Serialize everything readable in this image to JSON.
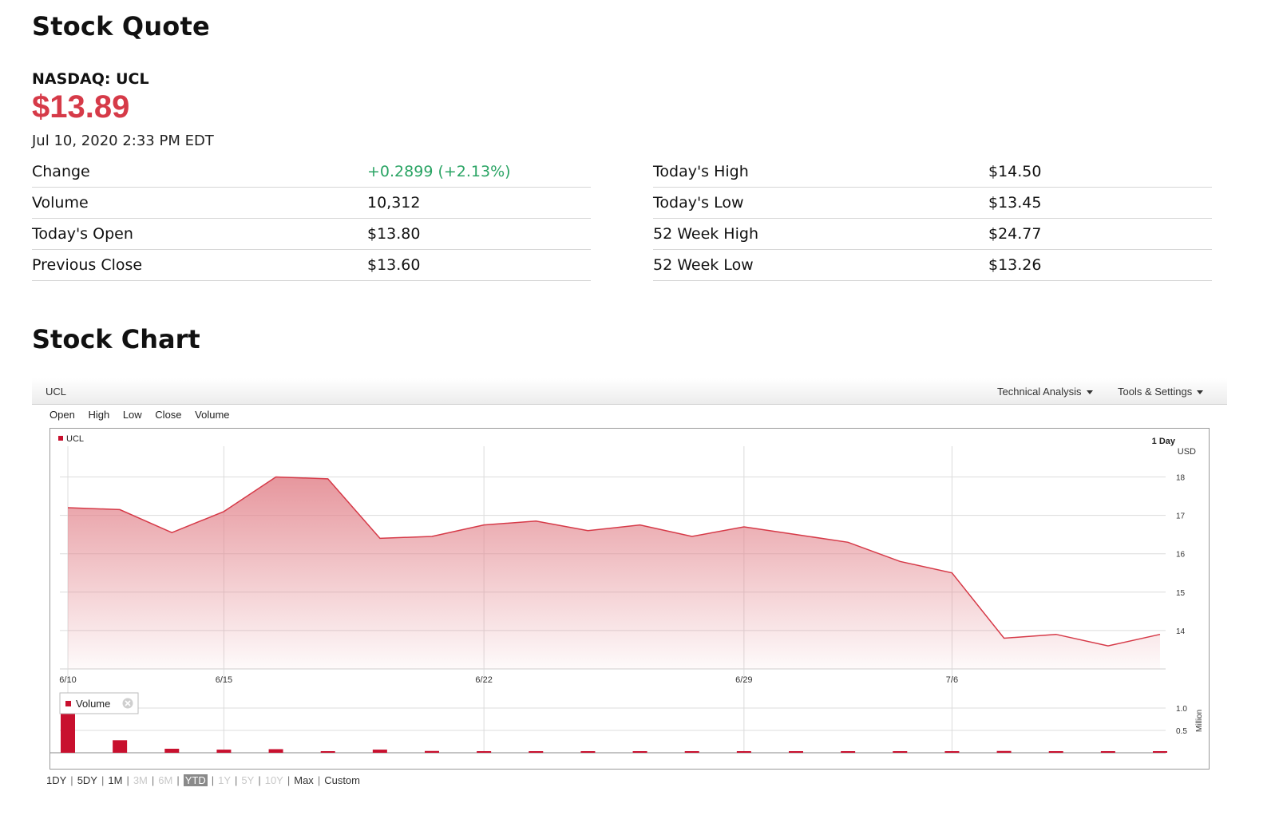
{
  "quote": {
    "title": "Stock Quote",
    "ticker": "NASDAQ: UCL",
    "price": "$13.89",
    "timestamp": "Jul 10, 2020 2:33 PM EDT",
    "left_rows": [
      {
        "label": "Change",
        "value": "+0.2899 (+2.13%)"
      },
      {
        "label": "Volume",
        "value": "10,312"
      },
      {
        "label": "Today's Open",
        "value": "$13.80"
      },
      {
        "label": "Previous Close",
        "value": "$13.60"
      }
    ],
    "right_rows": [
      {
        "label": "Today's High",
        "value": "$14.50"
      },
      {
        "label": "Today's Low",
        "value": "$13.45"
      },
      {
        "label": "52 Week High",
        "value": "$24.77"
      },
      {
        "label": "52 Week Low",
        "value": "$13.26"
      }
    ],
    "colors": {
      "price": "#d63a48",
      "up": "#2aa464"
    }
  },
  "chart_section": {
    "title": "Stock Chart",
    "symbol": "UCL",
    "menus": [
      "Technical Analysis",
      "Tools & Settings"
    ],
    "fields": [
      "Open",
      "High",
      "Low",
      "Close",
      "Volume"
    ],
    "interval": "1 Day",
    "currency": "USD",
    "legend": "UCL",
    "volume_legend": "Volume",
    "volume_unit": "Million",
    "ranges": [
      {
        "label": "1DY",
        "state": "enabled"
      },
      {
        "label": "5DY",
        "state": "enabled"
      },
      {
        "label": "1M",
        "state": "enabled"
      },
      {
        "label": "3M",
        "state": "disabled"
      },
      {
        "label": "6M",
        "state": "disabled"
      },
      {
        "label": "YTD",
        "state": "active"
      },
      {
        "label": "1Y",
        "state": "disabled"
      },
      {
        "label": "5Y",
        "state": "disabled"
      },
      {
        "label": "10Y",
        "state": "disabled"
      },
      {
        "label": "Max",
        "state": "enabled"
      },
      {
        "label": "Custom",
        "state": "enabled"
      }
    ]
  },
  "chart_data": {
    "type": "area",
    "series": [
      {
        "name": "UCL",
        "color": "#d63a48",
        "x": [
          "6/10",
          "6/11",
          "6/12",
          "6/15",
          "6/16",
          "6/17",
          "6/18",
          "6/19",
          "6/22",
          "6/23",
          "6/24",
          "6/25",
          "6/26",
          "6/29",
          "6/30",
          "7/1",
          "7/2",
          "7/6",
          "7/7",
          "7/8",
          "7/9",
          "7/10"
        ],
        "values": [
          17.2,
          17.15,
          16.55,
          17.1,
          18.0,
          17.95,
          16.4,
          16.45,
          16.75,
          16.85,
          16.6,
          16.75,
          16.45,
          16.7,
          16.5,
          16.3,
          15.8,
          15.5,
          13.8,
          13.9,
          13.6,
          13.9
        ]
      }
    ],
    "volume": {
      "name": "Volume",
      "unit": "Million",
      "values": [
        0.95,
        0.28,
        0.09,
        0.07,
        0.08,
        0.02,
        0.07,
        0.04,
        0.02,
        0.02,
        0.02,
        0.02,
        0.02,
        0.02,
        0.02,
        0.02,
        0.02,
        0.02,
        0.04,
        0.02,
        0.02,
        0.01
      ],
      "ticks": [
        "1.0",
        "0.5"
      ]
    },
    "x_ticks": [
      "6/10",
      "6/15",
      "6/22",
      "6/29",
      "7/6"
    ],
    "y_ticks": [
      14,
      15,
      16,
      17,
      18
    ],
    "ylim": [
      13.0,
      18.8
    ],
    "grid": true,
    "legend": "top-left",
    "ylabel": "USD"
  }
}
